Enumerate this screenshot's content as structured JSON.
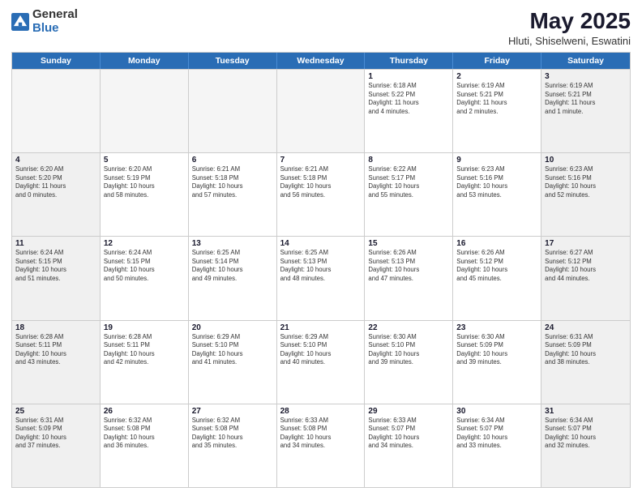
{
  "logo": {
    "general": "General",
    "blue": "Blue"
  },
  "title": "May 2025",
  "subtitle": "Hluti, Shiselweni, Eswatini",
  "weekdays": [
    "Sunday",
    "Monday",
    "Tuesday",
    "Wednesday",
    "Thursday",
    "Friday",
    "Saturday"
  ],
  "weeks": [
    [
      {
        "day": "",
        "info": "",
        "empty": true
      },
      {
        "day": "",
        "info": "",
        "empty": true
      },
      {
        "day": "",
        "info": "",
        "empty": true
      },
      {
        "day": "",
        "info": "",
        "empty": true
      },
      {
        "day": "1",
        "info": "Sunrise: 6:18 AM\nSunset: 5:22 PM\nDaylight: 11 hours\nand 4 minutes.",
        "empty": false,
        "shaded": false
      },
      {
        "day": "2",
        "info": "Sunrise: 6:19 AM\nSunset: 5:21 PM\nDaylight: 11 hours\nand 2 minutes.",
        "empty": false,
        "shaded": false
      },
      {
        "day": "3",
        "info": "Sunrise: 6:19 AM\nSunset: 5:21 PM\nDaylight: 11 hours\nand 1 minute.",
        "empty": false,
        "shaded": true
      }
    ],
    [
      {
        "day": "4",
        "info": "Sunrise: 6:20 AM\nSunset: 5:20 PM\nDaylight: 11 hours\nand 0 minutes.",
        "empty": false,
        "shaded": true
      },
      {
        "day": "5",
        "info": "Sunrise: 6:20 AM\nSunset: 5:19 PM\nDaylight: 10 hours\nand 58 minutes.",
        "empty": false,
        "shaded": false
      },
      {
        "day": "6",
        "info": "Sunrise: 6:21 AM\nSunset: 5:18 PM\nDaylight: 10 hours\nand 57 minutes.",
        "empty": false,
        "shaded": false
      },
      {
        "day": "7",
        "info": "Sunrise: 6:21 AM\nSunset: 5:18 PM\nDaylight: 10 hours\nand 56 minutes.",
        "empty": false,
        "shaded": false
      },
      {
        "day": "8",
        "info": "Sunrise: 6:22 AM\nSunset: 5:17 PM\nDaylight: 10 hours\nand 55 minutes.",
        "empty": false,
        "shaded": false
      },
      {
        "day": "9",
        "info": "Sunrise: 6:23 AM\nSunset: 5:16 PM\nDaylight: 10 hours\nand 53 minutes.",
        "empty": false,
        "shaded": false
      },
      {
        "day": "10",
        "info": "Sunrise: 6:23 AM\nSunset: 5:16 PM\nDaylight: 10 hours\nand 52 minutes.",
        "empty": false,
        "shaded": true
      }
    ],
    [
      {
        "day": "11",
        "info": "Sunrise: 6:24 AM\nSunset: 5:15 PM\nDaylight: 10 hours\nand 51 minutes.",
        "empty": false,
        "shaded": true
      },
      {
        "day": "12",
        "info": "Sunrise: 6:24 AM\nSunset: 5:15 PM\nDaylight: 10 hours\nand 50 minutes.",
        "empty": false,
        "shaded": false
      },
      {
        "day": "13",
        "info": "Sunrise: 6:25 AM\nSunset: 5:14 PM\nDaylight: 10 hours\nand 49 minutes.",
        "empty": false,
        "shaded": false
      },
      {
        "day": "14",
        "info": "Sunrise: 6:25 AM\nSunset: 5:13 PM\nDaylight: 10 hours\nand 48 minutes.",
        "empty": false,
        "shaded": false
      },
      {
        "day": "15",
        "info": "Sunrise: 6:26 AM\nSunset: 5:13 PM\nDaylight: 10 hours\nand 47 minutes.",
        "empty": false,
        "shaded": false
      },
      {
        "day": "16",
        "info": "Sunrise: 6:26 AM\nSunset: 5:12 PM\nDaylight: 10 hours\nand 45 minutes.",
        "empty": false,
        "shaded": false
      },
      {
        "day": "17",
        "info": "Sunrise: 6:27 AM\nSunset: 5:12 PM\nDaylight: 10 hours\nand 44 minutes.",
        "empty": false,
        "shaded": true
      }
    ],
    [
      {
        "day": "18",
        "info": "Sunrise: 6:28 AM\nSunset: 5:11 PM\nDaylight: 10 hours\nand 43 minutes.",
        "empty": false,
        "shaded": true
      },
      {
        "day": "19",
        "info": "Sunrise: 6:28 AM\nSunset: 5:11 PM\nDaylight: 10 hours\nand 42 minutes.",
        "empty": false,
        "shaded": false
      },
      {
        "day": "20",
        "info": "Sunrise: 6:29 AM\nSunset: 5:10 PM\nDaylight: 10 hours\nand 41 minutes.",
        "empty": false,
        "shaded": false
      },
      {
        "day": "21",
        "info": "Sunrise: 6:29 AM\nSunset: 5:10 PM\nDaylight: 10 hours\nand 40 minutes.",
        "empty": false,
        "shaded": false
      },
      {
        "day": "22",
        "info": "Sunrise: 6:30 AM\nSunset: 5:10 PM\nDaylight: 10 hours\nand 39 minutes.",
        "empty": false,
        "shaded": false
      },
      {
        "day": "23",
        "info": "Sunrise: 6:30 AM\nSunset: 5:09 PM\nDaylight: 10 hours\nand 39 minutes.",
        "empty": false,
        "shaded": false
      },
      {
        "day": "24",
        "info": "Sunrise: 6:31 AM\nSunset: 5:09 PM\nDaylight: 10 hours\nand 38 minutes.",
        "empty": false,
        "shaded": true
      }
    ],
    [
      {
        "day": "25",
        "info": "Sunrise: 6:31 AM\nSunset: 5:09 PM\nDaylight: 10 hours\nand 37 minutes.",
        "empty": false,
        "shaded": true
      },
      {
        "day": "26",
        "info": "Sunrise: 6:32 AM\nSunset: 5:08 PM\nDaylight: 10 hours\nand 36 minutes.",
        "empty": false,
        "shaded": false
      },
      {
        "day": "27",
        "info": "Sunrise: 6:32 AM\nSunset: 5:08 PM\nDaylight: 10 hours\nand 35 minutes.",
        "empty": false,
        "shaded": false
      },
      {
        "day": "28",
        "info": "Sunrise: 6:33 AM\nSunset: 5:08 PM\nDaylight: 10 hours\nand 34 minutes.",
        "empty": false,
        "shaded": false
      },
      {
        "day": "29",
        "info": "Sunrise: 6:33 AM\nSunset: 5:07 PM\nDaylight: 10 hours\nand 34 minutes.",
        "empty": false,
        "shaded": false
      },
      {
        "day": "30",
        "info": "Sunrise: 6:34 AM\nSunset: 5:07 PM\nDaylight: 10 hours\nand 33 minutes.",
        "empty": false,
        "shaded": false
      },
      {
        "day": "31",
        "info": "Sunrise: 6:34 AM\nSunset: 5:07 PM\nDaylight: 10 hours\nand 32 minutes.",
        "empty": false,
        "shaded": true
      }
    ]
  ]
}
